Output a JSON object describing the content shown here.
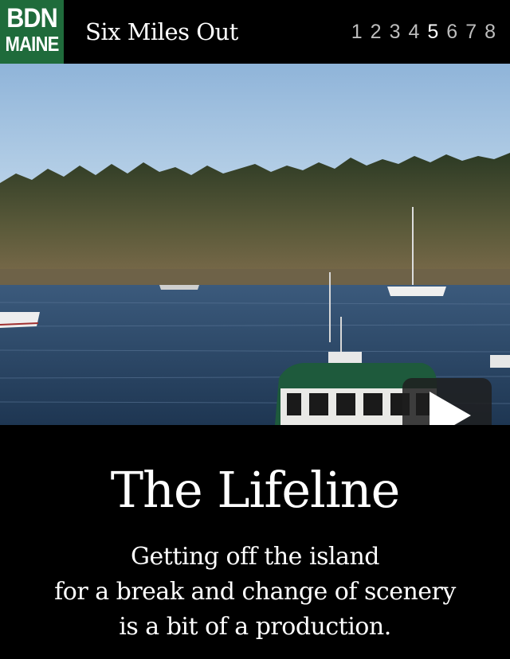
{
  "header": {
    "logo_line1": "BDN",
    "logo_line2": "MAINE",
    "series_title": "Six Miles Out",
    "pages": [
      "1",
      "2",
      "3",
      "4",
      "5",
      "6",
      "7",
      "8"
    ],
    "active_page": "5"
  },
  "hero": {
    "play_icon": "play-icon"
  },
  "story": {
    "title": "The Lifeline",
    "subtitle_lines": [
      "Getting off the island",
      "for a break and change of scenery",
      "is a bit of a production."
    ]
  },
  "colors": {
    "logo_green": "#1f6b3b",
    "background": "#000000",
    "text": "#ffffff"
  }
}
